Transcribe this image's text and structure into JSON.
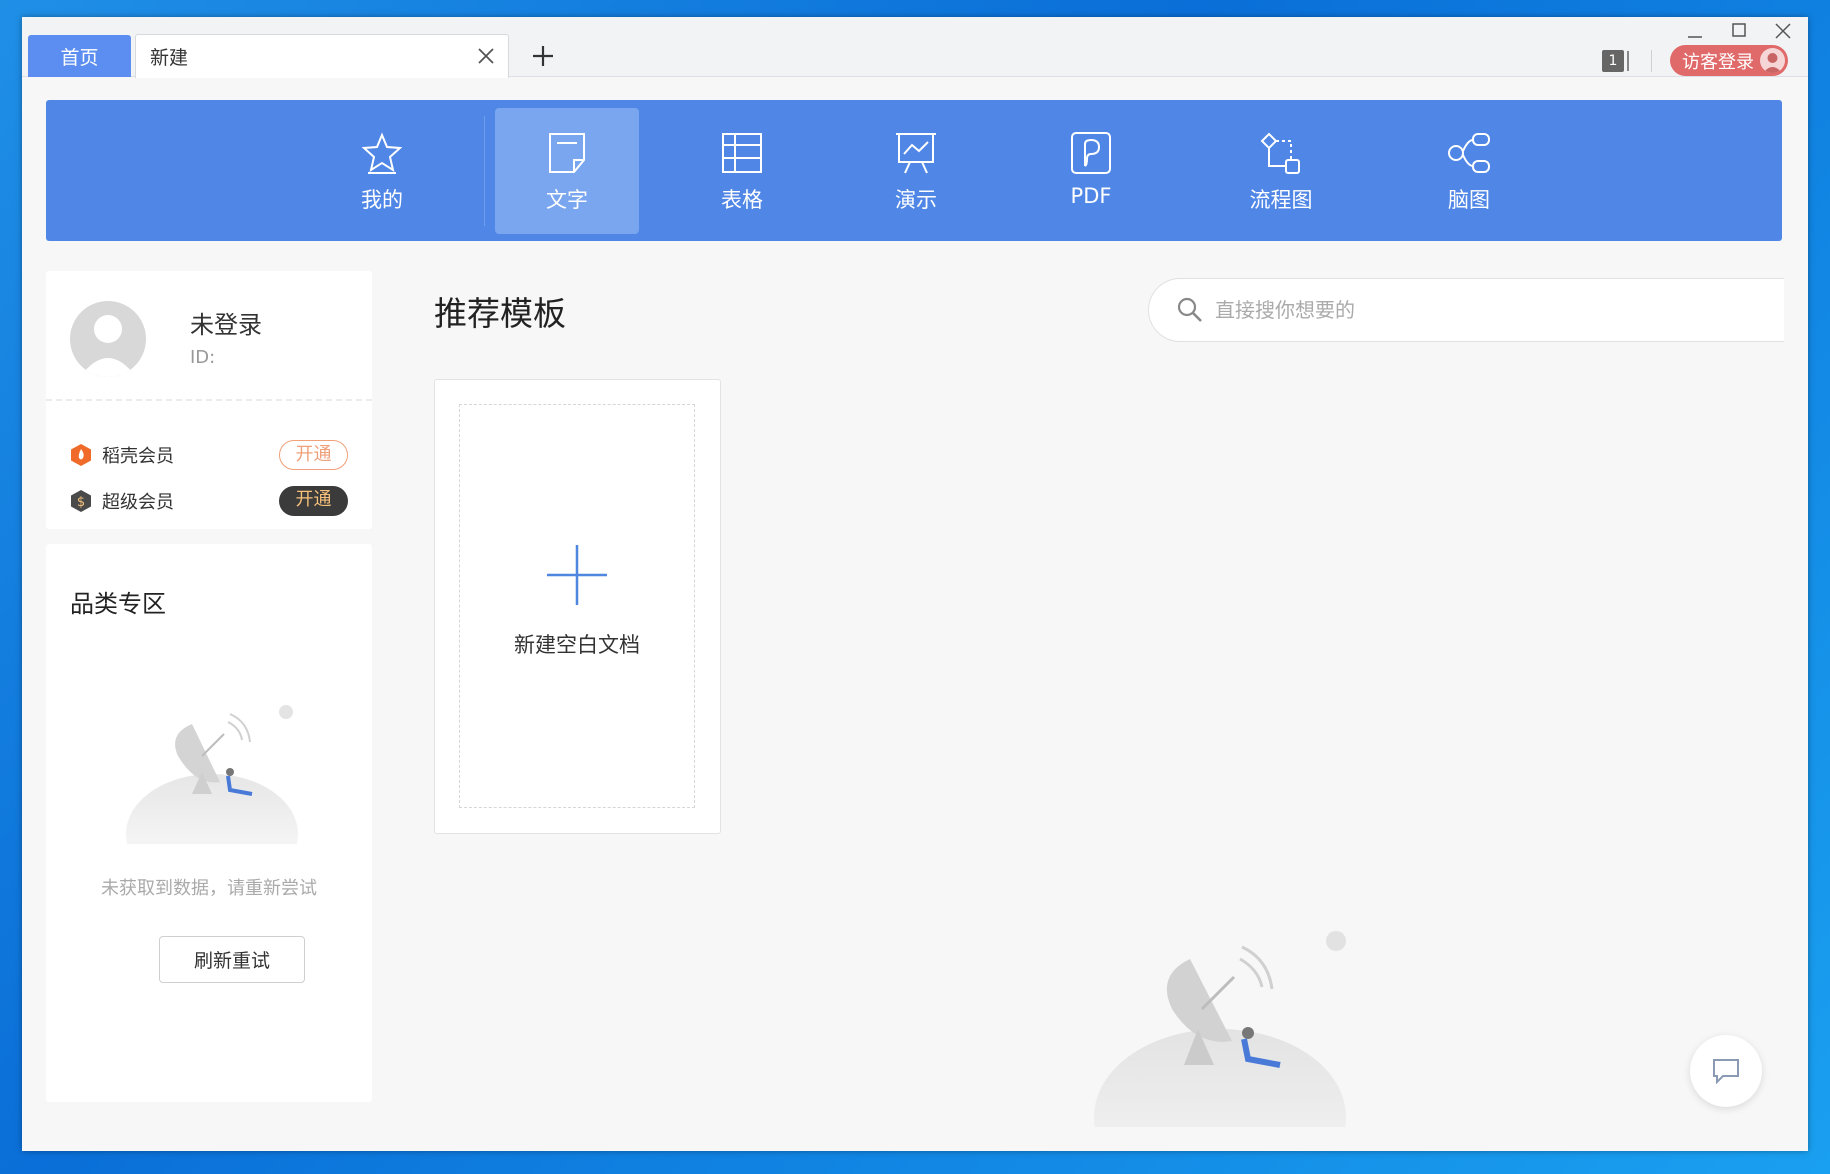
{
  "tabs": {
    "home": "首页",
    "current": "新建"
  },
  "titlebar": {
    "doc_count": "1",
    "guest_login": "访客登录"
  },
  "ribbon": {
    "items": [
      {
        "label": "我的",
        "icon": "star-icon"
      },
      {
        "label": "文字",
        "icon": "document-icon",
        "active": true
      },
      {
        "label": "表格",
        "icon": "table-icon"
      },
      {
        "label": "演示",
        "icon": "presentation-icon"
      },
      {
        "label": "PDF",
        "icon": "pdf-icon"
      },
      {
        "label": "流程图",
        "icon": "flowchart-icon"
      },
      {
        "label": "脑图",
        "icon": "mindmap-icon"
      }
    ]
  },
  "user": {
    "name": "未登录",
    "id_label": "ID:",
    "memberships": [
      {
        "label": "稻壳会员",
        "button": "开通",
        "color": "#f06a2a"
      },
      {
        "label": "超级会员",
        "button": "开通",
        "color": "#4a4a4a"
      }
    ]
  },
  "category": {
    "title": "品类专区",
    "empty_message": "未获取到数据，请重新尝试",
    "refresh_button": "刷新重试"
  },
  "main": {
    "section_title": "推荐模板",
    "search_placeholder": "直接搜你想要的",
    "new_blank": "新建空白文档"
  },
  "colors": {
    "accent": "#5087e6",
    "tab_home": "#5b8ef0",
    "guest": "#e06a6a"
  }
}
